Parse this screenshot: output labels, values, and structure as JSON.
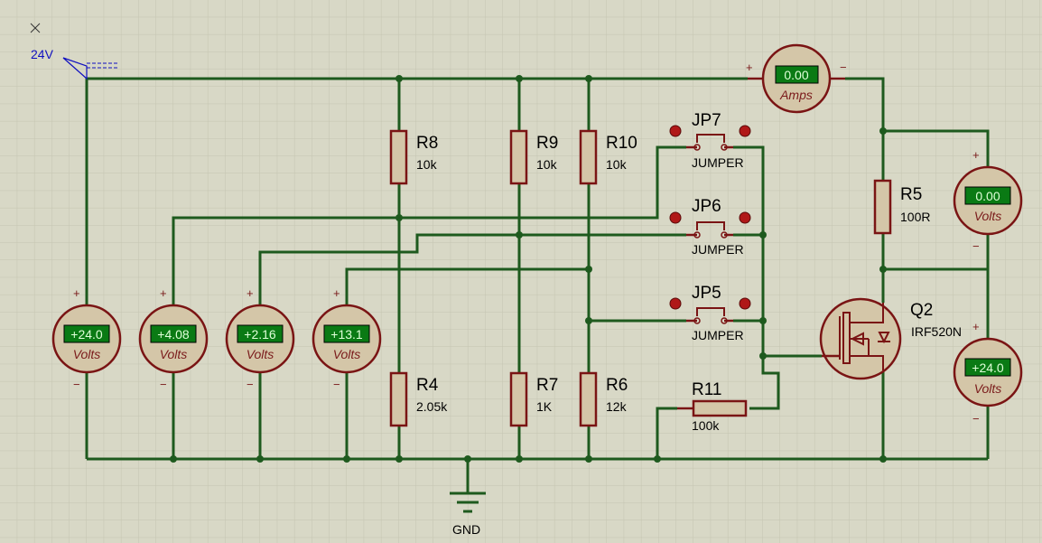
{
  "supply": {
    "label": "24V"
  },
  "ground": {
    "label": "GND"
  },
  "resistors": [
    {
      "ref": "R8",
      "value": "10k"
    },
    {
      "ref": "R9",
      "value": "10k"
    },
    {
      "ref": "R10",
      "value": "10k"
    },
    {
      "ref": "R4",
      "value": "2.05k"
    },
    {
      "ref": "R7",
      "value": "1K"
    },
    {
      "ref": "R6",
      "value": "12k"
    },
    {
      "ref": "R5",
      "value": "100R"
    },
    {
      "ref": "R11",
      "value": "100k"
    }
  ],
  "jumpers": [
    {
      "ref": "JP7",
      "type": "JUMPER"
    },
    {
      "ref": "JP6",
      "type": "JUMPER"
    },
    {
      "ref": "JP5",
      "type": "JUMPER"
    }
  ],
  "transistor": {
    "ref": "Q2",
    "part": "IRF520N"
  },
  "meters": [
    {
      "reading": "+24.0",
      "unit": "Volts"
    },
    {
      "reading": "+4.08",
      "unit": "Volts"
    },
    {
      "reading": "+2.16",
      "unit": "Volts"
    },
    {
      "reading": "+13.1",
      "unit": "Volts"
    },
    {
      "reading": "0.00",
      "unit": "Amps"
    },
    {
      "reading": "0.00",
      "unit": "Volts"
    },
    {
      "reading": "+24.0",
      "unit": "Volts"
    }
  ],
  "polarity": {
    "plus": "+",
    "minus": "−"
  },
  "colors": {
    "wire": "#1e5a1e",
    "component": "#7a1414",
    "display": "#0a7a14",
    "grid": "#c4c4b0"
  }
}
